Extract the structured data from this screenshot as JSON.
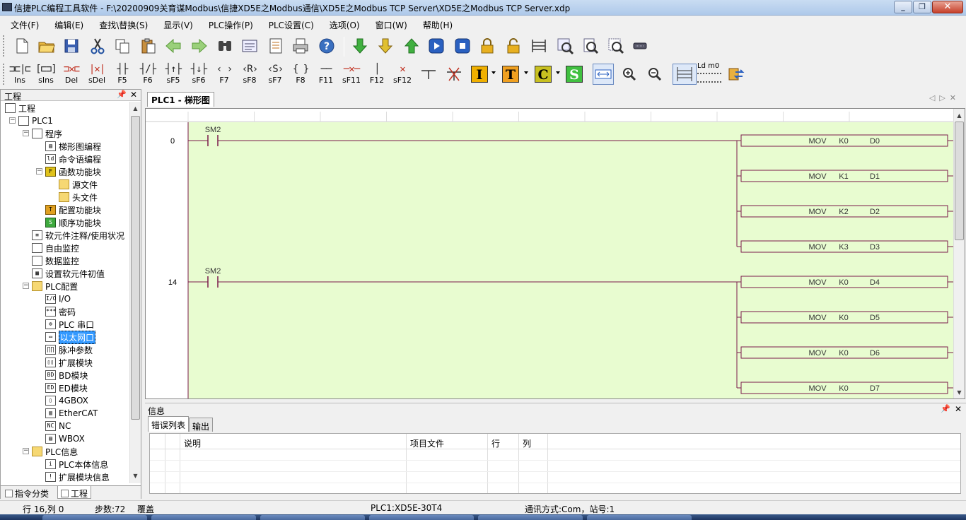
{
  "window": {
    "title": "信捷PLC编程工具软件 - F:\\20200909关育谋Modbus\\信捷XD5E之Modbus通信\\XD5E之Modbus TCP Server\\XD5E之Modbus TCP Server.xdp"
  },
  "menu": [
    "文件(F)",
    "编辑(E)",
    "查找\\替换(S)",
    "显示(V)",
    "PLC操作(P)",
    "PLC设置(C)",
    "选项(O)",
    "窗口(W)",
    "帮助(H)"
  ],
  "toolbar2": {
    "ladder_buttons": [
      {
        "sym": "⊐⊏|⊏",
        "label": "Ins"
      },
      {
        "sym": "[⊏⊐]",
        "label": "sIns"
      },
      {
        "sym": "⊐✕⊏",
        "label": "Del"
      },
      {
        "sym": "|✕|",
        "label": "sDel"
      },
      {
        "sym": "┤├",
        "label": "F5"
      },
      {
        "sym": "┤/├",
        "label": "F6"
      },
      {
        "sym": "┤↑├",
        "label": "sF5"
      },
      {
        "sym": "┤↓├",
        "label": "sF6"
      },
      {
        "sym": "‹ ›",
        "label": "F7"
      },
      {
        "sym": "‹R›",
        "label": "sF8"
      },
      {
        "sym": "‹S›",
        "label": "sF7"
      },
      {
        "sym": "{ }",
        "label": "F8"
      },
      {
        "sym": "──",
        "label": "F11"
      },
      {
        "sym": "─✕─",
        "label": "sF11"
      },
      {
        "sym": "│",
        "label": "F12"
      },
      {
        "sym": "✕",
        "label": "sF12"
      }
    ],
    "letters": [
      {
        "ch": "I",
        "color": "#f0b000"
      },
      {
        "ch": "T",
        "color": "#f0a020"
      },
      {
        "ch": "C",
        "color": "#c8c020"
      },
      {
        "ch": "S",
        "color": "#40c040"
      }
    ],
    "ld_label": "Ld m0"
  },
  "project_panel": {
    "title": "工程",
    "tree": [
      {
        "label": "工程",
        "level": 0,
        "icon": "doc",
        "exp": ""
      },
      {
        "label": "PLC1",
        "level": 1,
        "icon": "plc",
        "exp": "−"
      },
      {
        "label": "程序",
        "level": 2,
        "icon": "doc",
        "exp": "−"
      },
      {
        "label": "梯形图编程",
        "level": 3,
        "icon": "ladder",
        "exp": ""
      },
      {
        "label": "命令语编程",
        "level": 3,
        "icon": "il",
        "exp": ""
      },
      {
        "label": "函数功能块",
        "level": 3,
        "icon": "yellow",
        "exp": "−"
      },
      {
        "label": "源文件",
        "level": 4,
        "icon": "folder",
        "exp": ""
      },
      {
        "label": "头文件",
        "level": 4,
        "icon": "folder",
        "exp": ""
      },
      {
        "label": "配置功能块",
        "level": 3,
        "icon": "orange",
        "exp": ""
      },
      {
        "label": "顺序功能块",
        "level": 3,
        "icon": "green",
        "exp": ""
      },
      {
        "label": "软元件注释/使用状况",
        "level": 2,
        "icon": "list",
        "exp": ""
      },
      {
        "label": "自由监控",
        "level": 2,
        "icon": "doc",
        "exp": ""
      },
      {
        "label": "数据监控",
        "level": 2,
        "icon": "doc",
        "exp": ""
      },
      {
        "label": "设置软元件初值",
        "level": 2,
        "icon": "grid",
        "exp": ""
      },
      {
        "label": "PLC配置",
        "level": 2,
        "icon": "folder",
        "exp": "−"
      },
      {
        "label": "I/O",
        "level": 3,
        "icon": "io",
        "exp": ""
      },
      {
        "label": "密码",
        "level": 3,
        "icon": "pwd",
        "exp": ""
      },
      {
        "label": "PLC 串口",
        "level": 3,
        "icon": "serial",
        "exp": ""
      },
      {
        "label": "以太网口",
        "level": 3,
        "icon": "eth",
        "exp": "",
        "selected": true
      },
      {
        "label": "脉冲参数",
        "level": 3,
        "icon": "pulse",
        "exp": ""
      },
      {
        "label": "扩展模块",
        "level": 3,
        "icon": "ext",
        "exp": ""
      },
      {
        "label": "BD模块",
        "level": 3,
        "icon": "bd",
        "exp": ""
      },
      {
        "label": "ED模块",
        "level": 3,
        "icon": "ed",
        "exp": ""
      },
      {
        "label": "4GBOX",
        "level": 3,
        "icon": "box",
        "exp": ""
      },
      {
        "label": "EtherCAT",
        "level": 3,
        "icon": "ecat",
        "exp": ""
      },
      {
        "label": "NC",
        "level": 3,
        "icon": "nc",
        "exp": ""
      },
      {
        "label": "WBOX",
        "level": 3,
        "icon": "wbox",
        "exp": ""
      },
      {
        "label": "PLC信息",
        "level": 2,
        "icon": "folder",
        "exp": "−"
      },
      {
        "label": "PLC本体信息",
        "level": 3,
        "icon": "info",
        "exp": ""
      },
      {
        "label": "扩展模块信息",
        "level": 3,
        "icon": "extinfo",
        "exp": ""
      }
    ],
    "bottom_tabs": [
      "指令分类",
      "工程"
    ]
  },
  "document": {
    "tab": "PLC1 - 梯形图",
    "rungs": [
      {
        "step": "0",
        "contact": "SM2",
        "outputs": [
          {
            "op": "MOV",
            "src": "K0",
            "dst": "D0"
          },
          {
            "op": "MOV",
            "src": "K1",
            "dst": "D1"
          },
          {
            "op": "MOV",
            "src": "K2",
            "dst": "D2"
          },
          {
            "op": "MOV",
            "src": "K3",
            "dst": "D3"
          }
        ]
      },
      {
        "step": "14",
        "contact": "SM2",
        "outputs": [
          {
            "op": "MOV",
            "src": "K0",
            "dst": "D4"
          },
          {
            "op": "MOV",
            "src": "K0",
            "dst": "D5"
          },
          {
            "op": "MOV",
            "src": "K0",
            "dst": "D6"
          },
          {
            "op": "MOV",
            "src": "K0",
            "dst": "D7"
          }
        ]
      }
    ],
    "colors": {
      "background": "#e8fcd0",
      "wire": "#7a1a4a"
    }
  },
  "info_panel": {
    "title": "信息",
    "tabs": [
      "错误列表",
      "输出"
    ],
    "columns": [
      "说明",
      "项目文件",
      "行",
      "列"
    ]
  },
  "status": {
    "position": "行 16,列 0",
    "steps": "步数:72",
    "mode": "覆盖",
    "plc": "PLC1:XD5E-30T4",
    "comm": "通讯方式:Com，站号:1"
  }
}
